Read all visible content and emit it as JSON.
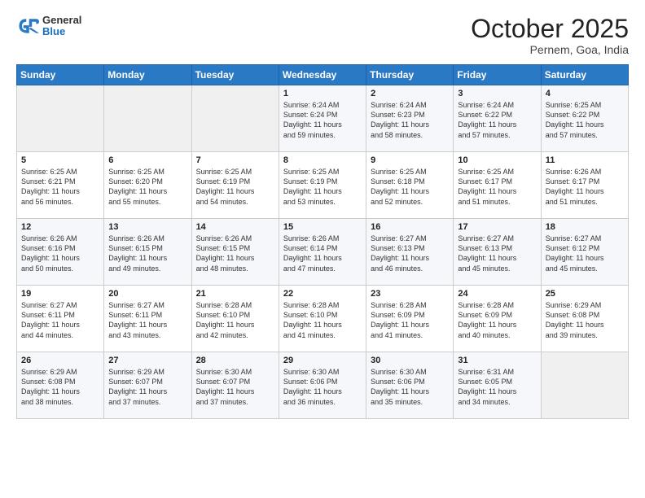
{
  "header": {
    "logo_general": "General",
    "logo_blue": "Blue",
    "month": "October 2025",
    "location": "Pernem, Goa, India"
  },
  "weekdays": [
    "Sunday",
    "Monday",
    "Tuesday",
    "Wednesday",
    "Thursday",
    "Friday",
    "Saturday"
  ],
  "weeks": [
    [
      {
        "day": "",
        "text": ""
      },
      {
        "day": "",
        "text": ""
      },
      {
        "day": "",
        "text": ""
      },
      {
        "day": "1",
        "text": "Sunrise: 6:24 AM\nSunset: 6:24 PM\nDaylight: 11 hours\nand 59 minutes."
      },
      {
        "day": "2",
        "text": "Sunrise: 6:24 AM\nSunset: 6:23 PM\nDaylight: 11 hours\nand 58 minutes."
      },
      {
        "day": "3",
        "text": "Sunrise: 6:24 AM\nSunset: 6:22 PM\nDaylight: 11 hours\nand 57 minutes."
      },
      {
        "day": "4",
        "text": "Sunrise: 6:25 AM\nSunset: 6:22 PM\nDaylight: 11 hours\nand 57 minutes."
      }
    ],
    [
      {
        "day": "5",
        "text": "Sunrise: 6:25 AM\nSunset: 6:21 PM\nDaylight: 11 hours\nand 56 minutes."
      },
      {
        "day": "6",
        "text": "Sunrise: 6:25 AM\nSunset: 6:20 PM\nDaylight: 11 hours\nand 55 minutes."
      },
      {
        "day": "7",
        "text": "Sunrise: 6:25 AM\nSunset: 6:19 PM\nDaylight: 11 hours\nand 54 minutes."
      },
      {
        "day": "8",
        "text": "Sunrise: 6:25 AM\nSunset: 6:19 PM\nDaylight: 11 hours\nand 53 minutes."
      },
      {
        "day": "9",
        "text": "Sunrise: 6:25 AM\nSunset: 6:18 PM\nDaylight: 11 hours\nand 52 minutes."
      },
      {
        "day": "10",
        "text": "Sunrise: 6:25 AM\nSunset: 6:17 PM\nDaylight: 11 hours\nand 51 minutes."
      },
      {
        "day": "11",
        "text": "Sunrise: 6:26 AM\nSunset: 6:17 PM\nDaylight: 11 hours\nand 51 minutes."
      }
    ],
    [
      {
        "day": "12",
        "text": "Sunrise: 6:26 AM\nSunset: 6:16 PM\nDaylight: 11 hours\nand 50 minutes."
      },
      {
        "day": "13",
        "text": "Sunrise: 6:26 AM\nSunset: 6:15 PM\nDaylight: 11 hours\nand 49 minutes."
      },
      {
        "day": "14",
        "text": "Sunrise: 6:26 AM\nSunset: 6:15 PM\nDaylight: 11 hours\nand 48 minutes."
      },
      {
        "day": "15",
        "text": "Sunrise: 6:26 AM\nSunset: 6:14 PM\nDaylight: 11 hours\nand 47 minutes."
      },
      {
        "day": "16",
        "text": "Sunrise: 6:27 AM\nSunset: 6:13 PM\nDaylight: 11 hours\nand 46 minutes."
      },
      {
        "day": "17",
        "text": "Sunrise: 6:27 AM\nSunset: 6:13 PM\nDaylight: 11 hours\nand 45 minutes."
      },
      {
        "day": "18",
        "text": "Sunrise: 6:27 AM\nSunset: 6:12 PM\nDaylight: 11 hours\nand 45 minutes."
      }
    ],
    [
      {
        "day": "19",
        "text": "Sunrise: 6:27 AM\nSunset: 6:11 PM\nDaylight: 11 hours\nand 44 minutes."
      },
      {
        "day": "20",
        "text": "Sunrise: 6:27 AM\nSunset: 6:11 PM\nDaylight: 11 hours\nand 43 minutes."
      },
      {
        "day": "21",
        "text": "Sunrise: 6:28 AM\nSunset: 6:10 PM\nDaylight: 11 hours\nand 42 minutes."
      },
      {
        "day": "22",
        "text": "Sunrise: 6:28 AM\nSunset: 6:10 PM\nDaylight: 11 hours\nand 41 minutes."
      },
      {
        "day": "23",
        "text": "Sunrise: 6:28 AM\nSunset: 6:09 PM\nDaylight: 11 hours\nand 41 minutes."
      },
      {
        "day": "24",
        "text": "Sunrise: 6:28 AM\nSunset: 6:09 PM\nDaylight: 11 hours\nand 40 minutes."
      },
      {
        "day": "25",
        "text": "Sunrise: 6:29 AM\nSunset: 6:08 PM\nDaylight: 11 hours\nand 39 minutes."
      }
    ],
    [
      {
        "day": "26",
        "text": "Sunrise: 6:29 AM\nSunset: 6:08 PM\nDaylight: 11 hours\nand 38 minutes."
      },
      {
        "day": "27",
        "text": "Sunrise: 6:29 AM\nSunset: 6:07 PM\nDaylight: 11 hours\nand 37 minutes."
      },
      {
        "day": "28",
        "text": "Sunrise: 6:30 AM\nSunset: 6:07 PM\nDaylight: 11 hours\nand 37 minutes."
      },
      {
        "day": "29",
        "text": "Sunrise: 6:30 AM\nSunset: 6:06 PM\nDaylight: 11 hours\nand 36 minutes."
      },
      {
        "day": "30",
        "text": "Sunrise: 6:30 AM\nSunset: 6:06 PM\nDaylight: 11 hours\nand 35 minutes."
      },
      {
        "day": "31",
        "text": "Sunrise: 6:31 AM\nSunset: 6:05 PM\nDaylight: 11 hours\nand 34 minutes."
      },
      {
        "day": "",
        "text": ""
      }
    ]
  ]
}
